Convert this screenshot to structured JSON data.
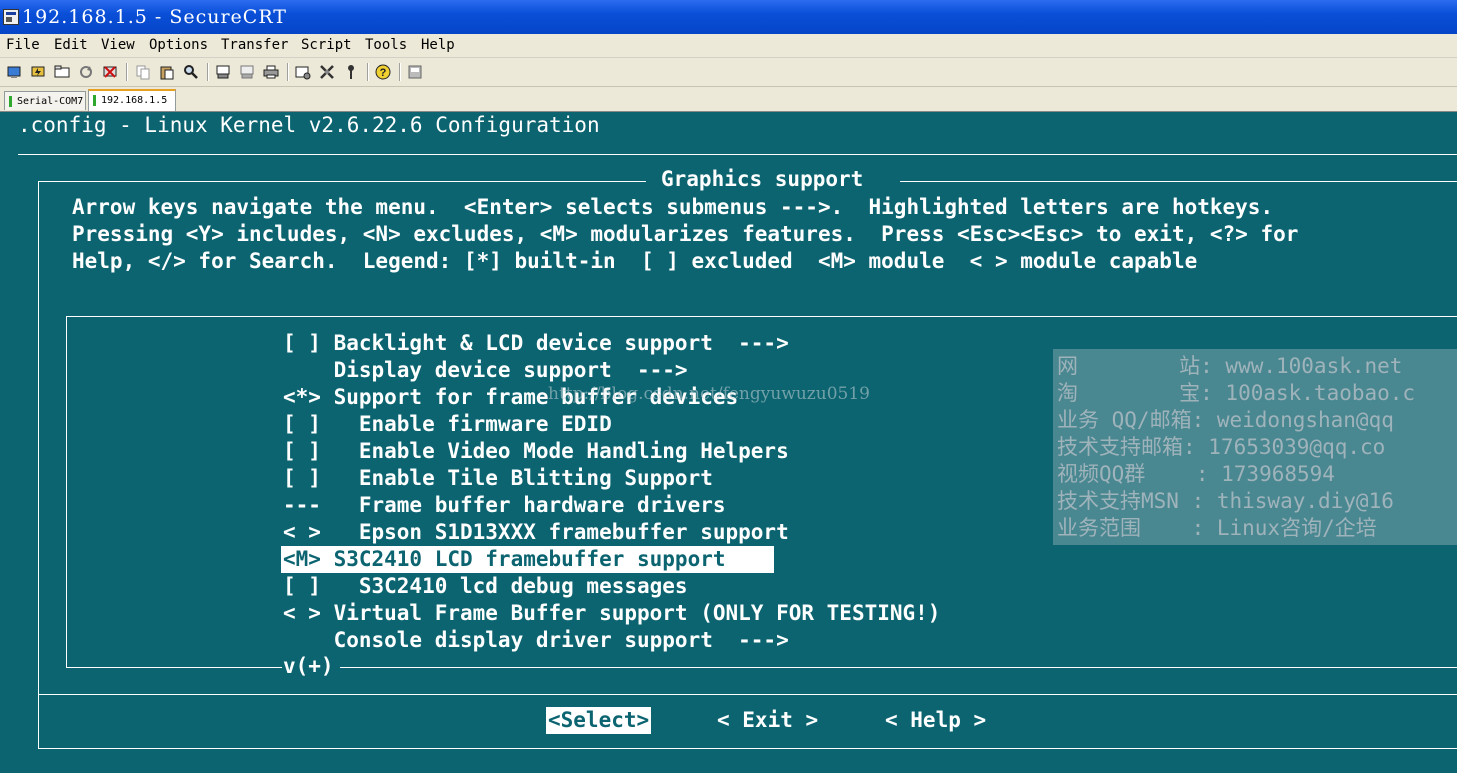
{
  "window": {
    "title": "192.168.1.5 - SecureCRT"
  },
  "menu": [
    "File",
    "Edit",
    "View",
    "Options",
    "Transfer",
    "Script",
    "Tools",
    "Help"
  ],
  "toolbar_icons": [
    "connect-icon",
    "quick-connect-icon",
    "connect-tab-icon",
    "reconnect-icon",
    "disconnect-icon",
    "copy-icon",
    "paste-icon",
    "find-icon",
    "print-screen-icon",
    "print-selection-icon",
    "printer-icon",
    "session-options-icon",
    "global-options-icon",
    "keymap-icon",
    "help-icon",
    "sftp-icon"
  ],
  "tabs": [
    {
      "label": "Serial-COM7",
      "active": false
    },
    {
      "label": "192.168.1.5",
      "active": true
    }
  ],
  "terminal": {
    "header": ".config - Linux Kernel v2.6.22.6 Configuration",
    "dialog_title": "Graphics support",
    "help_lines": [
      "Arrow keys navigate the menu.  <Enter> selects submenus --->.  Highlighted letters are hotkeys.",
      "Pressing <Y> includes, <N> excludes, <M> modularizes features.  Press <Esc><Esc> to exit, <?> for",
      "Help, </> for Search.  Legend: [*] built-in  [ ] excluded  <M> module  < > module capable"
    ],
    "menu_items": [
      {
        "text": "[ ] Backlight & LCD device support  --->",
        "selected": false
      },
      {
        "text": "    Display device support  --->",
        "selected": false
      },
      {
        "text": "<*> Support for frame buffer devices",
        "selected": false
      },
      {
        "text": "[ ]   Enable firmware EDID",
        "selected": false
      },
      {
        "text": "[ ]   Enable Video Mode Handling Helpers",
        "selected": false
      },
      {
        "text": "[ ]   Enable Tile Blitting Support",
        "selected": false
      },
      {
        "text": "---   Frame buffer hardware drivers",
        "selected": false
      },
      {
        "text": "< >   Epson S1D13XXX framebuffer support",
        "selected": false
      },
      {
        "text": "<M> S3C2410 LCD framebuffer support",
        "selected": true
      },
      {
        "text": "[ ]   S3C2410 lcd debug messages",
        "selected": false
      },
      {
        "text": "< > Virtual Frame Buffer support (ONLY FOR TESTING!)",
        "selected": false
      },
      {
        "text": "    Console display driver support  --->",
        "selected": false
      }
    ],
    "more_indicator": "v(+)",
    "buttons": [
      {
        "label": "<Select>",
        "active": true
      },
      {
        "label": "< Exit >",
        "active": false
      },
      {
        "label": "< Help >",
        "active": false
      }
    ]
  },
  "overlay_ad": [
    "网        站: www.100ask.net",
    "淘        宝: 100ask.taobao.c",
    "业务 QQ/邮箱: weidongshan@qq",
    "技术支持邮箱: 17653039@qq.co",
    "视频QQ群    : 173968594",
    "技术支持MSN : thisway.diy@16",
    "业务范围    : Linux咨询/企培"
  ],
  "watermark": "http://blog.csdn.net/fengyuwuzu0519",
  "colors": {
    "terminal_bg": "#0b6470",
    "text": "#ffffff",
    "titlebar": "#0a4fd8"
  }
}
